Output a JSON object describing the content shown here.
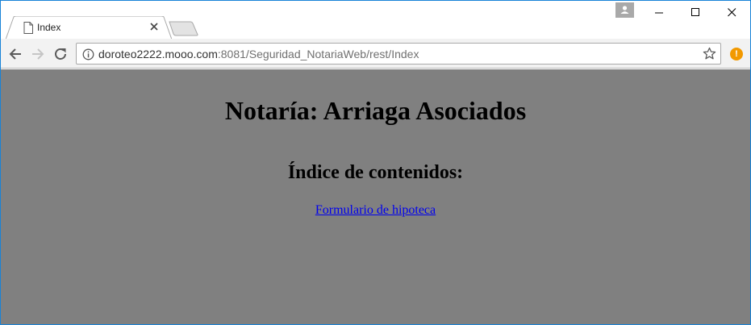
{
  "browser": {
    "tab": {
      "title": "Index",
      "favicon": "page-icon",
      "close_icon": "close-icon"
    },
    "new_tab_icon": "new-tab-icon",
    "profile_icon": "person-icon",
    "window_controls": [
      "minimize-icon",
      "maximize-icon",
      "close-icon"
    ],
    "toolbar": {
      "back_icon": "arrow-left-icon",
      "forward_icon": "arrow-right-icon",
      "reload_icon": "reload-icon",
      "site_info_icon": "info-icon",
      "bookmark_icon": "star-icon",
      "extension_badge": "!"
    },
    "address": {
      "host": "doroteo2222.mooo.com",
      "rest": ":8081/Seguridad_NotariaWeb/rest/Index"
    }
  },
  "page": {
    "title": "Notaría: Arriaga Asociados",
    "section_heading": "Índice de contenidos:",
    "links": [
      {
        "label": "Formulario de hipoteca"
      }
    ]
  },
  "colors": {
    "page_background": "#808080",
    "link": "#0000ee",
    "window_border": "#1883d7",
    "extension_badge": "#f29900"
  }
}
